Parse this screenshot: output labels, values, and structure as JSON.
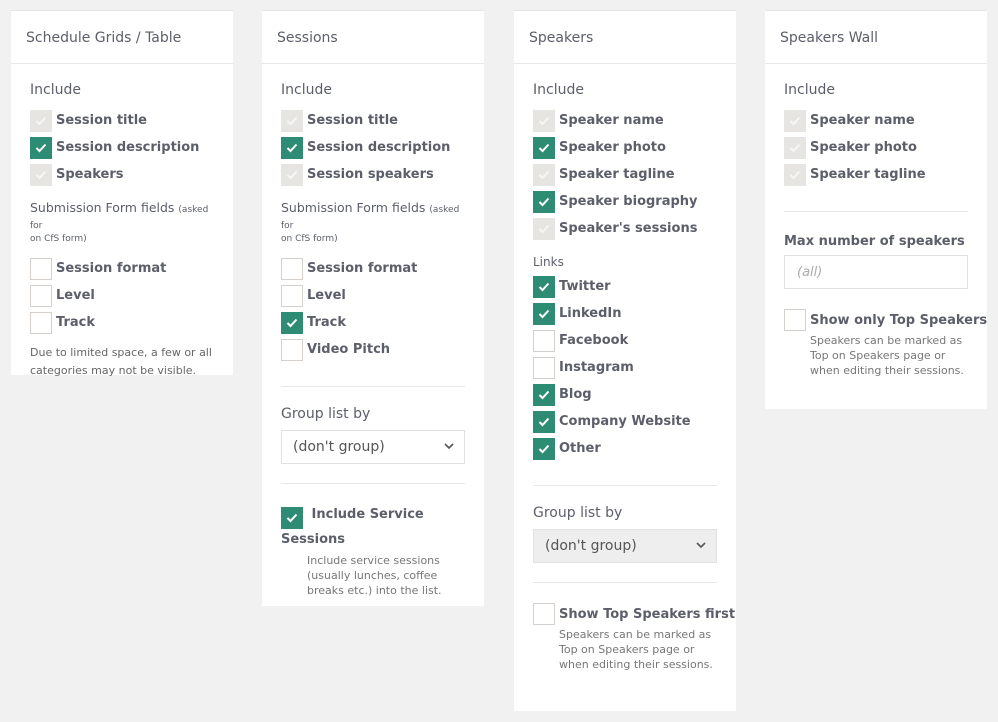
{
  "colors": {
    "accent": "#2e8b74",
    "background": "#f1f1f1",
    "disabled_check": "#e7e5e2"
  },
  "schedule": {
    "title": "Schedule Grids / Table",
    "include_label": "Include",
    "include": [
      {
        "label": "Session title",
        "state": "disabled"
      },
      {
        "label": "Session description",
        "state": "checked"
      },
      {
        "label": "Speakers",
        "state": "disabled"
      }
    ],
    "submission_title": "Submission Form fields",
    "submission_note": "(asked for",
    "submission_note2": "on CfS form)",
    "submission": [
      {
        "label": "Session format",
        "state": "unchecked"
      },
      {
        "label": "Level",
        "state": "unchecked"
      },
      {
        "label": "Track",
        "state": "unchecked"
      }
    ],
    "help": "Due to limited space, a few or all categories may not be visible."
  },
  "sessions": {
    "title": "Sessions",
    "include_label": "Include",
    "include": [
      {
        "label": "Session title",
        "state": "disabled"
      },
      {
        "label": "Session description",
        "state": "checked"
      },
      {
        "label": "Session speakers",
        "state": "disabled"
      }
    ],
    "submission_title": "Submission Form fields",
    "submission_note": "(asked for",
    "submission_note2": "on CfS form)",
    "submission": [
      {
        "label": "Session format",
        "state": "unchecked"
      },
      {
        "label": "Level",
        "state": "unchecked"
      },
      {
        "label": "Track",
        "state": "checked"
      },
      {
        "label": "Video Pitch",
        "state": "unchecked"
      }
    ],
    "group_label": "Group list by",
    "group_value": "(don't group)",
    "service_label": "Include Service Sessions",
    "service_state": "checked",
    "service_desc": "Include service sessions (usually lunches, coffee breaks etc.) into the list."
  },
  "speakers": {
    "title": "Speakers",
    "include_label": "Include",
    "include": [
      {
        "label": "Speaker name",
        "state": "disabled"
      },
      {
        "label": "Speaker photo",
        "state": "checked"
      },
      {
        "label": "Speaker tagline",
        "state": "disabled"
      },
      {
        "label": "Speaker biography",
        "state": "checked"
      },
      {
        "label": "Speaker's sessions",
        "state": "disabled"
      }
    ],
    "links_label": "Links",
    "links": [
      {
        "label": "Twitter",
        "state": "checked"
      },
      {
        "label": "LinkedIn",
        "state": "checked"
      },
      {
        "label": "Facebook",
        "state": "unchecked"
      },
      {
        "label": "Instagram",
        "state": "unchecked"
      },
      {
        "label": "Blog",
        "state": "checked"
      },
      {
        "label": "Company Website",
        "state": "checked"
      },
      {
        "label": "Other",
        "state": "checked"
      }
    ],
    "group_label": "Group list by",
    "group_value": "(don't group)",
    "top_label": "Show Top Speakers first",
    "top_state": "unchecked",
    "top_desc": "Speakers can be marked as Top on Speakers page or when editing their sessions."
  },
  "wall": {
    "title": "Speakers Wall",
    "include_label": "Include",
    "include": [
      {
        "label": "Speaker name",
        "state": "disabled"
      },
      {
        "label": "Speaker photo",
        "state": "disabled"
      },
      {
        "label": "Speaker tagline",
        "state": "disabled"
      }
    ],
    "max_label": "Max number of speakers",
    "max_placeholder": "(all)",
    "max_value": "",
    "top_label": "Show only Top Speakers",
    "top_state": "unchecked",
    "top_desc": "Speakers can be marked as Top on Speakers page or when editing their sessions."
  }
}
